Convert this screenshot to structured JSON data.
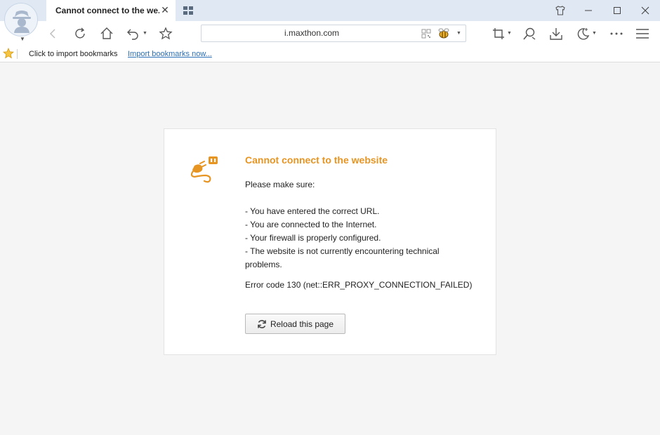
{
  "tab": {
    "title": "Cannot connect to the we...",
    "close_glyph": "✕"
  },
  "address": {
    "url": "i.maxthon.com"
  },
  "bookmarks": {
    "prompt": "Click to import bookmarks",
    "import_link": "Import bookmarks now..."
  },
  "error": {
    "title": "Cannot connect to the website",
    "intro": "Please make sure:",
    "checks": [
      "- You have entered the correct URL.",
      "- You are connected to the Internet.",
      "- Your firewall is properly configured.",
      "- The website is not currently encountering technical problems."
    ],
    "code": "Error code 130 (net::ERR_PROXY_CONNECTION_FAILED)",
    "reload_label": "Reload this page"
  },
  "colors": {
    "accent": "#e69523",
    "tabstrip": "#dfe8f3",
    "link": "#2b6fb6"
  },
  "icons": [
    "incognito-avatar-icon",
    "tab-grid-icon",
    "skin-icon",
    "minimize-icon",
    "maximize-icon",
    "close-icon",
    "back-icon",
    "refresh-icon",
    "home-icon",
    "undo-icon",
    "favorite-star-icon",
    "qr-code-icon",
    "bee-icon",
    "screenshot-icon",
    "search-zoom-icon",
    "download-icon",
    "night-mode-icon",
    "more-icon",
    "menu-icon",
    "unplugged-icon",
    "reload-icon"
  ]
}
